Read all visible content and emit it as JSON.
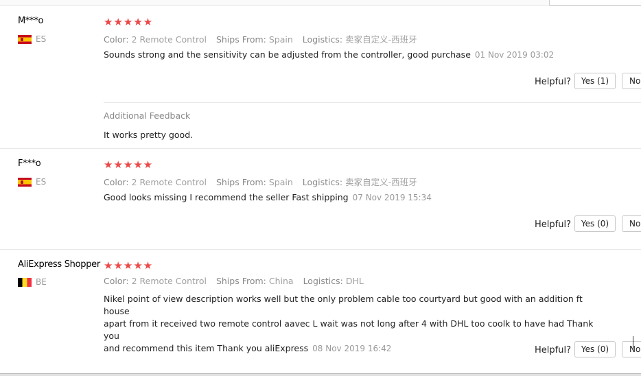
{
  "reviews": [
    {
      "name": "M***o",
      "country": "ES",
      "flag": "spain-flag-icon",
      "stars": "★★★★★",
      "rating": 5,
      "color_label": "Color:",
      "color_value": "2 Remote Control",
      "ships_label": "Ships From:",
      "ships_value": "Spain",
      "logistics_label": "Logistics:",
      "logistics_value": "卖家自定义-西班牙",
      "text": "Sounds strong and the sensitivity can be adjusted from the controller, good purchase",
      "date": "01 Nov 2019 03:02",
      "helpful_label": "Helpful?",
      "yes_label": "Yes (1)",
      "no_label": "No",
      "feedback_title": "Additional Feedback",
      "feedback_text": "It works pretty good."
    },
    {
      "name": "F***o",
      "country": "ES",
      "flag": "spain-flag-icon",
      "stars": "★★★★★",
      "rating": 5,
      "color_label": "Color:",
      "color_value": "2 Remote Control",
      "ships_label": "Ships From:",
      "ships_value": "Spain",
      "logistics_label": "Logistics:",
      "logistics_value": "卖家自定义-西班牙",
      "text": "Good looks missing I recommend the seller Fast shipping",
      "date": "07 Nov 2019 15:34",
      "helpful_label": "Helpful?",
      "yes_label": "Yes (0)",
      "no_label": "No"
    },
    {
      "name": "AliExpress Shopper",
      "country": "BE",
      "flag": "belgium-flag-icon",
      "stars": "★★★★★",
      "rating": 5,
      "color_label": "Color:",
      "color_value": "2 Remote Control",
      "ships_label": "Ships From:",
      "ships_value": "China",
      "logistics_label": "Logistics:",
      "logistics_value": "DHL",
      "text_lines": [
        "Nikel point of view description works well but the only problem cable too courtyard but good with an addition ft house",
        "apart from it received two remote control aavec L wait was not long after 4 with DHL too coolk to have had Thank you",
        "and recommend this item Thank you aliExpress"
      ],
      "date": "08 Nov 2019 16:42",
      "helpful_label": "Helpful?",
      "yes_label": "Yes (0)",
      "no_label": "No"
    }
  ]
}
